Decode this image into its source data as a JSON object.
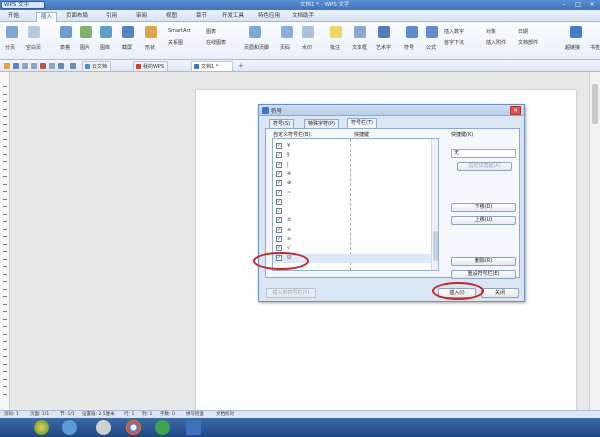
{
  "app": {
    "badge": "WPS 文字",
    "title": "文档1 * - WPS 文字",
    "window_buttons": [
      "–",
      "□",
      "×"
    ]
  },
  "menu": {
    "tabs": [
      "开始",
      "插入",
      "页面布局",
      "引用",
      "审阅",
      "视图",
      "章节",
      "开发工具",
      "特色应用",
      "文档助手"
    ],
    "active": "插入"
  },
  "ribbon": {
    "items": [
      "分页",
      "空白页",
      "表格",
      "图片",
      "图库",
      "截屏",
      "形状",
      "SmartArt",
      "关系图",
      "图表",
      "在线图表",
      "页眉和页脚",
      "页码",
      "水印",
      "批注",
      "文本框",
      "艺术字",
      "符号",
      "公式",
      "插入数字",
      "对象",
      "日期",
      "首字下沉",
      "插入附件",
      "文档部件",
      "超链接",
      "书签"
    ]
  },
  "doc_tabs": [
    {
      "label": "云文档"
    },
    {
      "label": "我的WPS"
    },
    {
      "label": "文档1 *"
    }
  ],
  "dialog": {
    "title": "符号",
    "tabs": [
      "符号(S)",
      "特殊字符(P)",
      "符号栏(T)"
    ],
    "active_tab": "符号栏(T)",
    "col_symbol": "自定义符号栏(B):",
    "col_shortcut": "快捷键",
    "shortcut_label": "快捷键(K)",
    "shortcut_value": "无",
    "symbols": [
      "¥",
      "§",
      "|",
      "※",
      "⊕",
      "~",
      "",
      "",
      "±",
      "≤",
      "≥",
      "√",
      "☑"
    ],
    "buttons": {
      "assign": "指定快捷键(A)",
      "move_down": "下移(D)",
      "move_up": "上移(U)",
      "delete": "删除(R)",
      "reset": "重设符号栏(E)",
      "insert": "插入(I)",
      "close": "关闭",
      "insert_shortcut": "插入到符号栏(Y)"
    }
  },
  "status": {
    "items": [
      "页码: 1",
      "页面: 1/1",
      "节: 1/1",
      "设置值: 2.5厘米",
      "行: 1",
      "列: 1",
      "字数: 0",
      "拼写检查",
      "文档校对"
    ]
  }
}
